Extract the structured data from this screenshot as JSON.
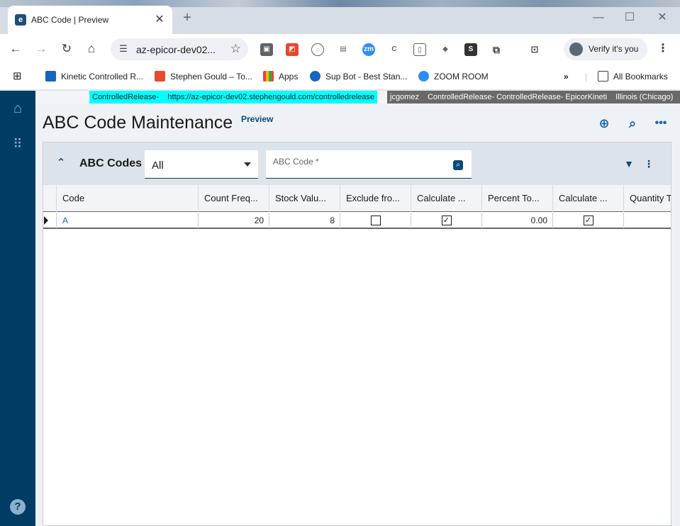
{
  "browser": {
    "tab_title": "ABC Code | Preview",
    "tab_favicon_glyph": "e",
    "url": "az-epicor-dev02...",
    "verify_label": "Verify it's you",
    "bookmarks": [
      {
        "label": "Kinetic Controlled R...",
        "color": "#1665c0"
      },
      {
        "label": "Stephen Gould – To...",
        "color": "#e8492d"
      },
      {
        "label": "Apps",
        "color": "#f2a600"
      },
      {
        "label": "Sup Bot - Best Stan...",
        "color": "#1665c0"
      },
      {
        "label": "ZOOM ROOM",
        "color": "#2d8cff"
      }
    ],
    "all_bookmarks_label": "All Bookmarks"
  },
  "env": {
    "release": "ControlledRelease-",
    "url": "https://az-epicor-dev02.stephengould.com/controlledrelease",
    "user": "jcgomez",
    "company": "ControlledRelease- ControlledRelease- EpicorKineti",
    "site": "Illinois (Chicago)"
  },
  "page": {
    "title": "ABC Code Maintenance",
    "preview_label": "Preview"
  },
  "panel": {
    "title": "ABC Codes",
    "filter_value": "All",
    "search_placeholder": "ABC Code *"
  },
  "grid": {
    "columns": [
      "Code",
      "Count Freq...",
      "Stock Valu...",
      "Exclude fro...",
      "Calculate ...",
      "Percent To...",
      "Calculate ...",
      "Quantity T"
    ],
    "rows": [
      {
        "code": "A",
        "count_freq": "20",
        "stock_value": "8",
        "exclude_from": false,
        "calculate_1": true,
        "percent_to": "0.00",
        "calculate_2": true,
        "quantity": ""
      }
    ]
  },
  "colors": {
    "nav": "#003c64",
    "accent": "#1667a8",
    "env_cyan": "#00ffff",
    "env_gray": "#696969"
  }
}
